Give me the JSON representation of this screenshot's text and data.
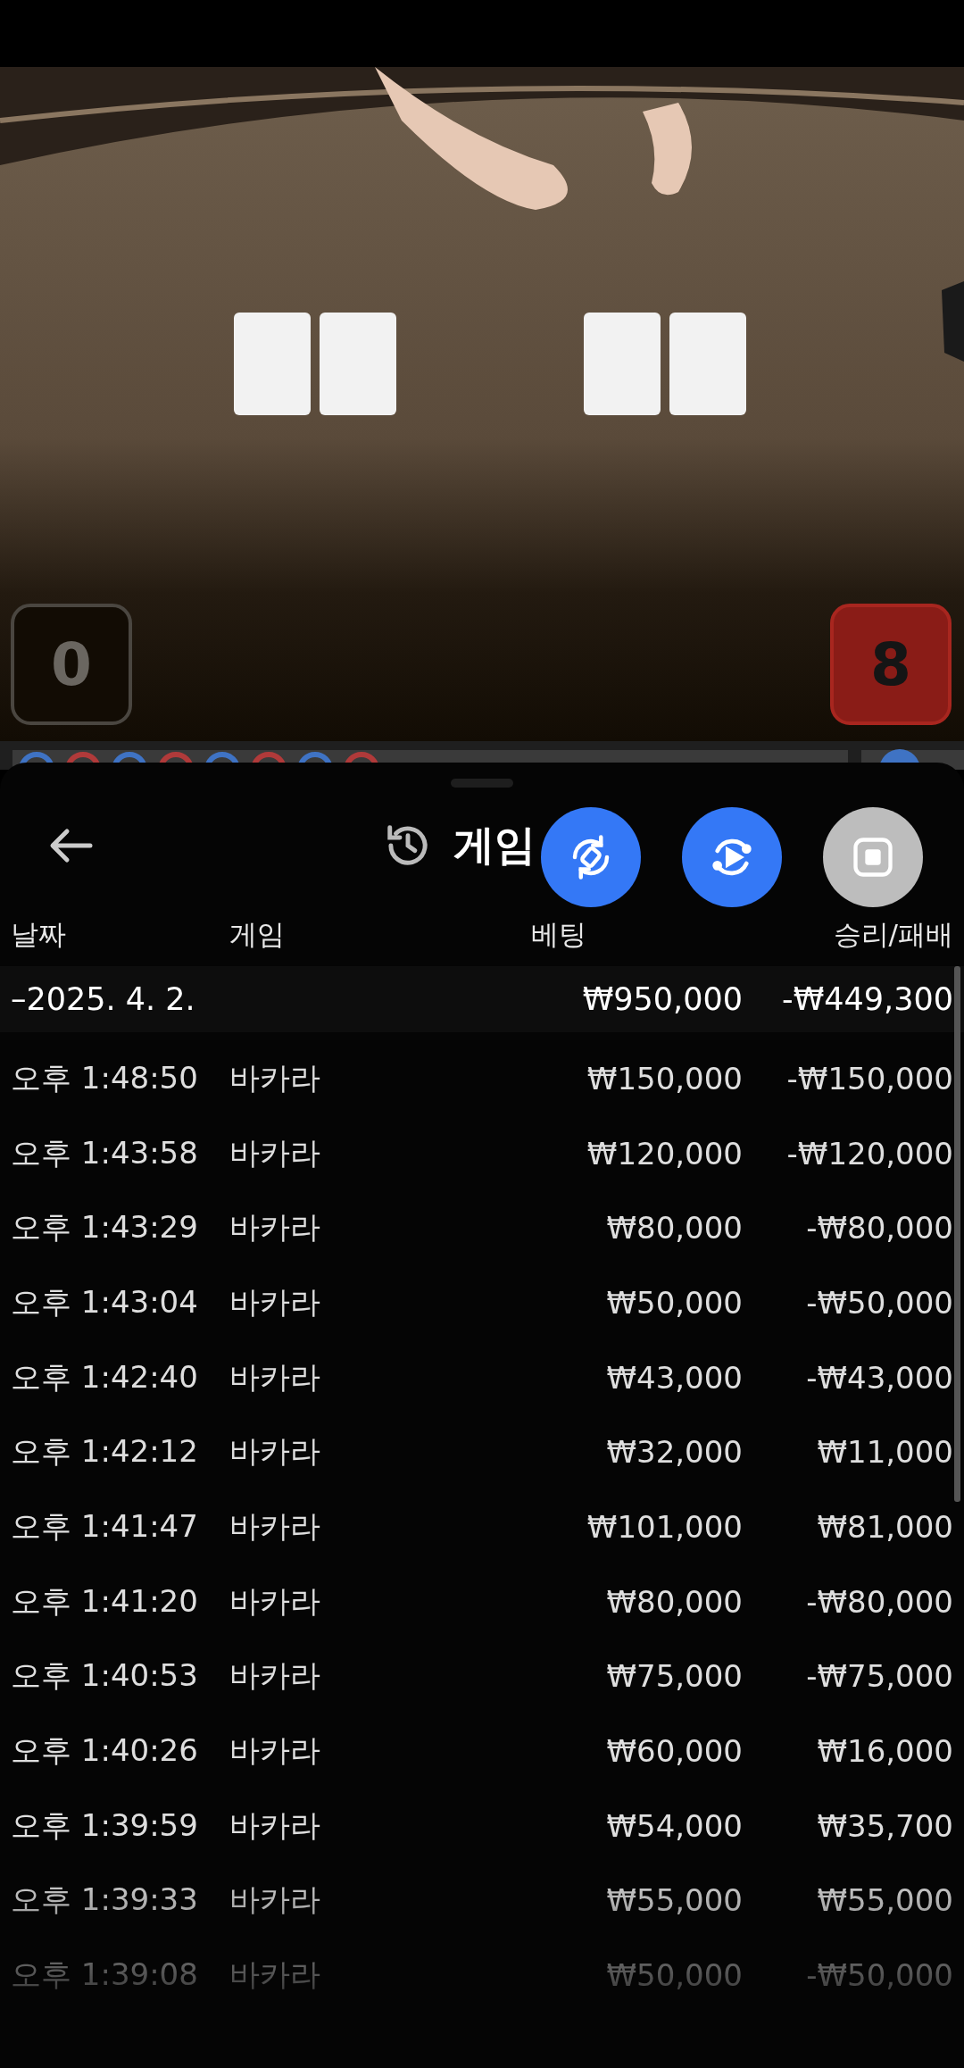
{
  "video": {
    "player_score": "0",
    "banker_score": "8"
  },
  "history": {
    "title": "게임",
    "columns": [
      "날짜",
      "게임",
      "베팅",
      "승리/패배"
    ],
    "date_group": {
      "date": "–2025. 4. 2.",
      "bet": "₩950,000",
      "result": "-₩449,300"
    },
    "rows": [
      {
        "time": "오후 1:48:50",
        "game": "바카라",
        "bet": "₩150,000",
        "result": "-₩150,000"
      },
      {
        "time": "오후 1:43:58",
        "game": "바카라",
        "bet": "₩120,000",
        "result": "-₩120,000"
      },
      {
        "time": "오후 1:43:29",
        "game": "바카라",
        "bet": "₩80,000",
        "result": "-₩80,000"
      },
      {
        "time": "오후 1:43:04",
        "game": "바카라",
        "bet": "₩50,000",
        "result": "-₩50,000"
      },
      {
        "time": "오후 1:42:40",
        "game": "바카라",
        "bet": "₩43,000",
        "result": "-₩43,000"
      },
      {
        "time": "오후 1:42:12",
        "game": "바카라",
        "bet": "₩32,000",
        "result": "₩11,000"
      },
      {
        "time": "오후 1:41:47",
        "game": "바카라",
        "bet": "₩101,000",
        "result": "₩81,000"
      },
      {
        "time": "오후 1:41:20",
        "game": "바카라",
        "bet": "₩80,000",
        "result": "-₩80,000"
      },
      {
        "time": "오후 1:40:53",
        "game": "바카라",
        "bet": "₩75,000",
        "result": "-₩75,000"
      },
      {
        "time": "오후 1:40:26",
        "game": "바카라",
        "bet": "₩60,000",
        "result": "₩16,000"
      },
      {
        "time": "오후 1:39:59",
        "game": "바카라",
        "bet": "₩54,000",
        "result": "₩35,700"
      },
      {
        "time": "오후 1:39:33",
        "game": "바카라",
        "bet": "₩55,000",
        "result": "₩55,000"
      },
      {
        "time": "오후 1:39:08",
        "game": "바카라",
        "bet": "₩50,000",
        "result": "-₩50,000"
      }
    ]
  },
  "floating_buttons": [
    {
      "kind": "rotate"
    },
    {
      "kind": "replay"
    },
    {
      "kind": "stop"
    }
  ]
}
